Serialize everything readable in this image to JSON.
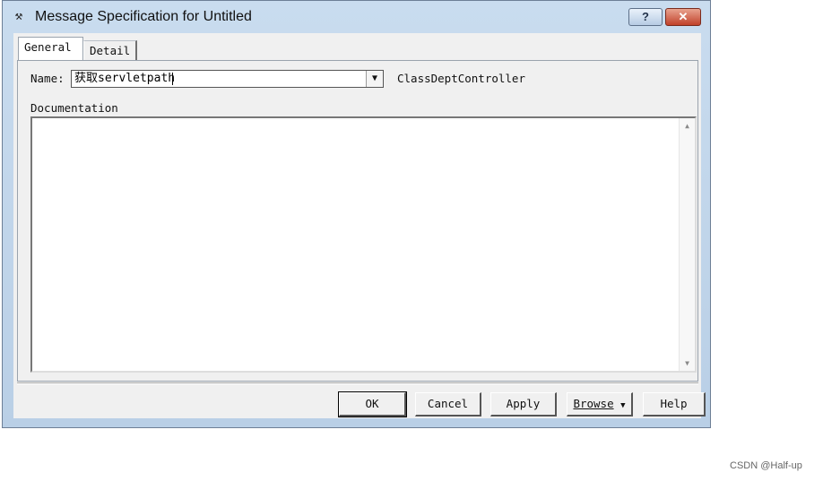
{
  "window": {
    "title": "Message Specification for Untitled",
    "help_label": "?",
    "close_label": "✕",
    "icon": "app-tool-icon"
  },
  "tabs": [
    {
      "label": "General",
      "active": true
    },
    {
      "label": "Detail",
      "active": false
    }
  ],
  "form": {
    "name_label": "Name:",
    "name_value": "获取servletpath",
    "class_label": "ClassDeptController",
    "documentation_label": "Documentation",
    "documentation_value": ""
  },
  "buttons": {
    "ok": "OK",
    "cancel": "Cancel",
    "apply": "Apply",
    "browse": "Browse",
    "browse_arrow": "▼",
    "help": "Help"
  },
  "watermark": "CSDN @Half-up"
}
